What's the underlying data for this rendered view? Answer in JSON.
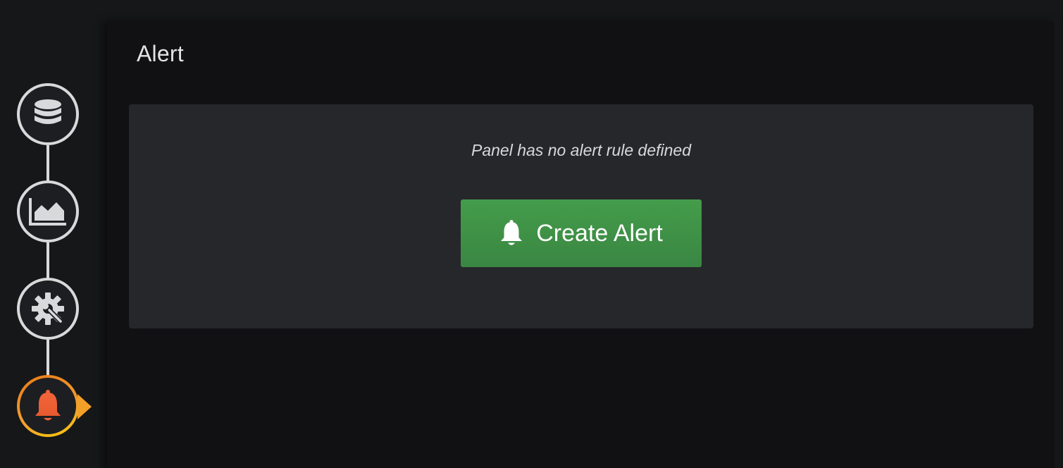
{
  "rail": {
    "steps": [
      {
        "name": "queries",
        "icon": "database-icon"
      },
      {
        "name": "visualization",
        "icon": "area-chart-icon"
      },
      {
        "name": "general",
        "icon": "cog-wrench-icon"
      },
      {
        "name": "alert",
        "icon": "bell-icon",
        "active": true
      }
    ]
  },
  "main": {
    "title": "Alert",
    "empty_state": {
      "message": "Panel has no alert rule defined",
      "button_label": "Create Alert",
      "button_icon": "bell-icon"
    }
  },
  "colors": {
    "accent_orange": "#eb7b18",
    "button_green": "#3f934a",
    "card_bg": "#26272b",
    "panel_bg": "#111113"
  }
}
